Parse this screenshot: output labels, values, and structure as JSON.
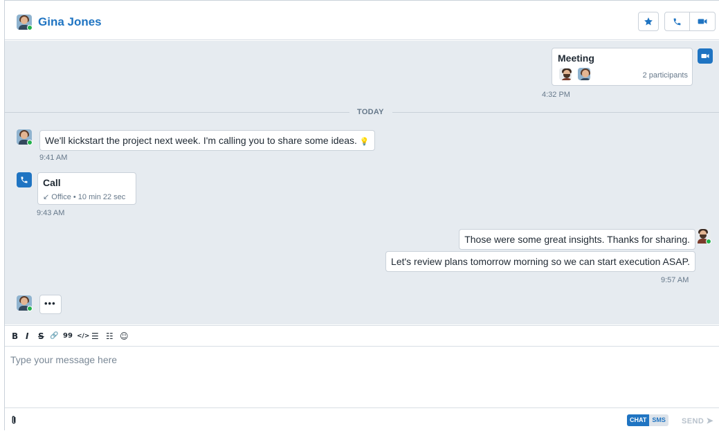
{
  "header": {
    "contact_name": "Gina Jones",
    "status": "online",
    "buttons": {
      "favorite": "star-icon",
      "call": "phone-icon",
      "video": "video-icon"
    }
  },
  "messages": {
    "meeting": {
      "title": "Meeting",
      "participants": "2 participants",
      "time": "4:32 PM"
    },
    "date_divider": "TODAY",
    "incoming_1": {
      "text": "We'll kickstart the project next week. I'm calling you to share some ideas.",
      "emoji": "💡",
      "time": "9:41 AM"
    },
    "call": {
      "title": "Call",
      "detail_arrow": "↙",
      "location": "Office",
      "separator": "•",
      "duration": "10 min 22 sec",
      "time": "9:43 AM"
    },
    "outgoing_1": {
      "text": "Those were some great insights. Thanks for sharing."
    },
    "outgoing_2": {
      "text": "Let's review plans tomorrow morning so we can start execution ASAP.",
      "time": "9:57 AM"
    },
    "typing": "•••"
  },
  "toolbar": {
    "bold": "B",
    "italic": "I",
    "strike": "S",
    "link": "🔗",
    "quote": "99",
    "code": "</>",
    "bullet_list": "☰",
    "numbered_list": "☷",
    "emoji": "☺"
  },
  "composer": {
    "placeholder": "Type your message here",
    "mode_chat": "CHAT",
    "mode_sms": "SMS",
    "send_label": "SEND"
  },
  "colors": {
    "accent": "#1f74c2",
    "online": "#22b14c",
    "chat_bg": "#e6ebf0"
  }
}
